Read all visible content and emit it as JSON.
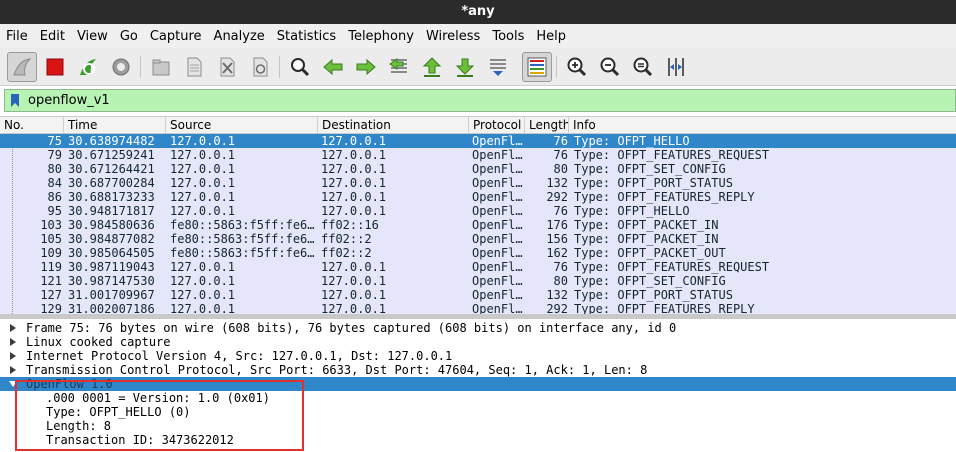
{
  "window": {
    "title": "*any"
  },
  "menu": [
    "File",
    "Edit",
    "View",
    "Go",
    "Capture",
    "Analyze",
    "Statistics",
    "Telephony",
    "Wireless",
    "Tools",
    "Help"
  ],
  "toolbar_icons": [
    "shark-fin-start-icon",
    "stop-icon",
    "restart-icon",
    "capture-options-gear-icon",
    "open-file-icon",
    "save-file-icon",
    "close-file-icon",
    "reload-file-icon",
    "find-packet-icon",
    "go-back-icon",
    "go-forward-icon",
    "go-to-packet-icon",
    "first-packet-icon",
    "last-packet-icon",
    "autoscroll-icon",
    "colorize-icon",
    "zoom-in-icon",
    "zoom-out-icon",
    "zoom-normal-icon",
    "resize-columns-icon"
  ],
  "filter": {
    "value": "openflow_v1"
  },
  "columns": {
    "no": "No.",
    "time": "Time",
    "source": "Source",
    "destination": "Destination",
    "protocol": "Protocol",
    "length": "Length",
    "info": "Info"
  },
  "packets": [
    {
      "no": "75",
      "time": "30.638974482",
      "source": "127.0.0.1",
      "destination": "127.0.0.1",
      "protocol": "OpenFl…",
      "length": "76",
      "info": "Type: OFPT_HELLO",
      "selected": true
    },
    {
      "no": "79",
      "time": "30.671259241",
      "source": "127.0.0.1",
      "destination": "127.0.0.1",
      "protocol": "OpenFl…",
      "length": "76",
      "info": "Type: OFPT_FEATURES_REQUEST"
    },
    {
      "no": "80",
      "time": "30.671264421",
      "source": "127.0.0.1",
      "destination": "127.0.0.1",
      "protocol": "OpenFl…",
      "length": "80",
      "info": "Type: OFPT_SET_CONFIG"
    },
    {
      "no": "84",
      "time": "30.687700284",
      "source": "127.0.0.1",
      "destination": "127.0.0.1",
      "protocol": "OpenFl…",
      "length": "132",
      "info": "Type: OFPT_PORT_STATUS"
    },
    {
      "no": "86",
      "time": "30.688173233",
      "source": "127.0.0.1",
      "destination": "127.0.0.1",
      "protocol": "OpenFl…",
      "length": "292",
      "info": "Type: OFPT_FEATURES_REPLY"
    },
    {
      "no": "95",
      "time": "30.948171817",
      "source": "127.0.0.1",
      "destination": "127.0.0.1",
      "protocol": "OpenFl…",
      "length": "76",
      "info": "Type: OFPT_HELLO"
    },
    {
      "no": "103",
      "time": "30.984580636",
      "source": "fe80::5863:f5ff:fe6…",
      "destination": "ff02::16",
      "protocol": "OpenFl…",
      "length": "176",
      "info": "Type: OFPT_PACKET_IN"
    },
    {
      "no": "105",
      "time": "30.984877082",
      "source": "fe80::5863:f5ff:fe6…",
      "destination": "ff02::2",
      "protocol": "OpenFl…",
      "length": "156",
      "info": "Type: OFPT_PACKET_IN"
    },
    {
      "no": "109",
      "time": "30.985064505",
      "source": "fe80::5863:f5ff:fe6…",
      "destination": "ff02::2",
      "protocol": "OpenFl…",
      "length": "162",
      "info": "Type: OFPT_PACKET_OUT"
    },
    {
      "no": "119",
      "time": "30.987119043",
      "source": "127.0.0.1",
      "destination": "127.0.0.1",
      "protocol": "OpenFl…",
      "length": "76",
      "info": "Type: OFPT_FEATURES_REQUEST"
    },
    {
      "no": "121",
      "time": "30.987147530",
      "source": "127.0.0.1",
      "destination": "127.0.0.1",
      "protocol": "OpenFl…",
      "length": "80",
      "info": "Type: OFPT_SET_CONFIG"
    },
    {
      "no": "127",
      "time": "31.001709967",
      "source": "127.0.0.1",
      "destination": "127.0.0.1",
      "protocol": "OpenFl…",
      "length": "132",
      "info": "Type: OFPT_PORT_STATUS"
    },
    {
      "no": "129",
      "time": "31.002007186",
      "source": "127.0.0.1",
      "destination": "127.0.0.1",
      "protocol": "OpenFl…",
      "length": "292",
      "info": "Type: OFPT_FEATURES_REPLY"
    }
  ],
  "details": [
    {
      "text": "Frame 75: 76 bytes on wire (608 bits), 76 bytes captured (608 bits) on interface any, id 0",
      "expanded": false
    },
    {
      "text": "Linux cooked capture",
      "expanded": false
    },
    {
      "text": "Internet Protocol Version 4, Src: 127.0.0.1, Dst: 127.0.0.1",
      "expanded": false
    },
    {
      "text": "Transmission Control Protocol, Src Port: 6633, Dst Port: 47604, Seq: 1, Ack: 1, Len: 8",
      "expanded": false
    },
    {
      "text": "OpenFlow 1.0",
      "expanded": true,
      "selected": true
    }
  ],
  "openflow_fields": [
    ".000 0001 = Version: 1.0 (0x01)",
    "Type: OFPT_HELLO (0)",
    "Length: 8",
    "Transaction ID: 3473622012"
  ],
  "colors": {
    "selection": "#2f86c8",
    "list_background": "#e6e6fa",
    "filter_valid": "#b7f3b3",
    "highlight_box": "#e2302e"
  }
}
